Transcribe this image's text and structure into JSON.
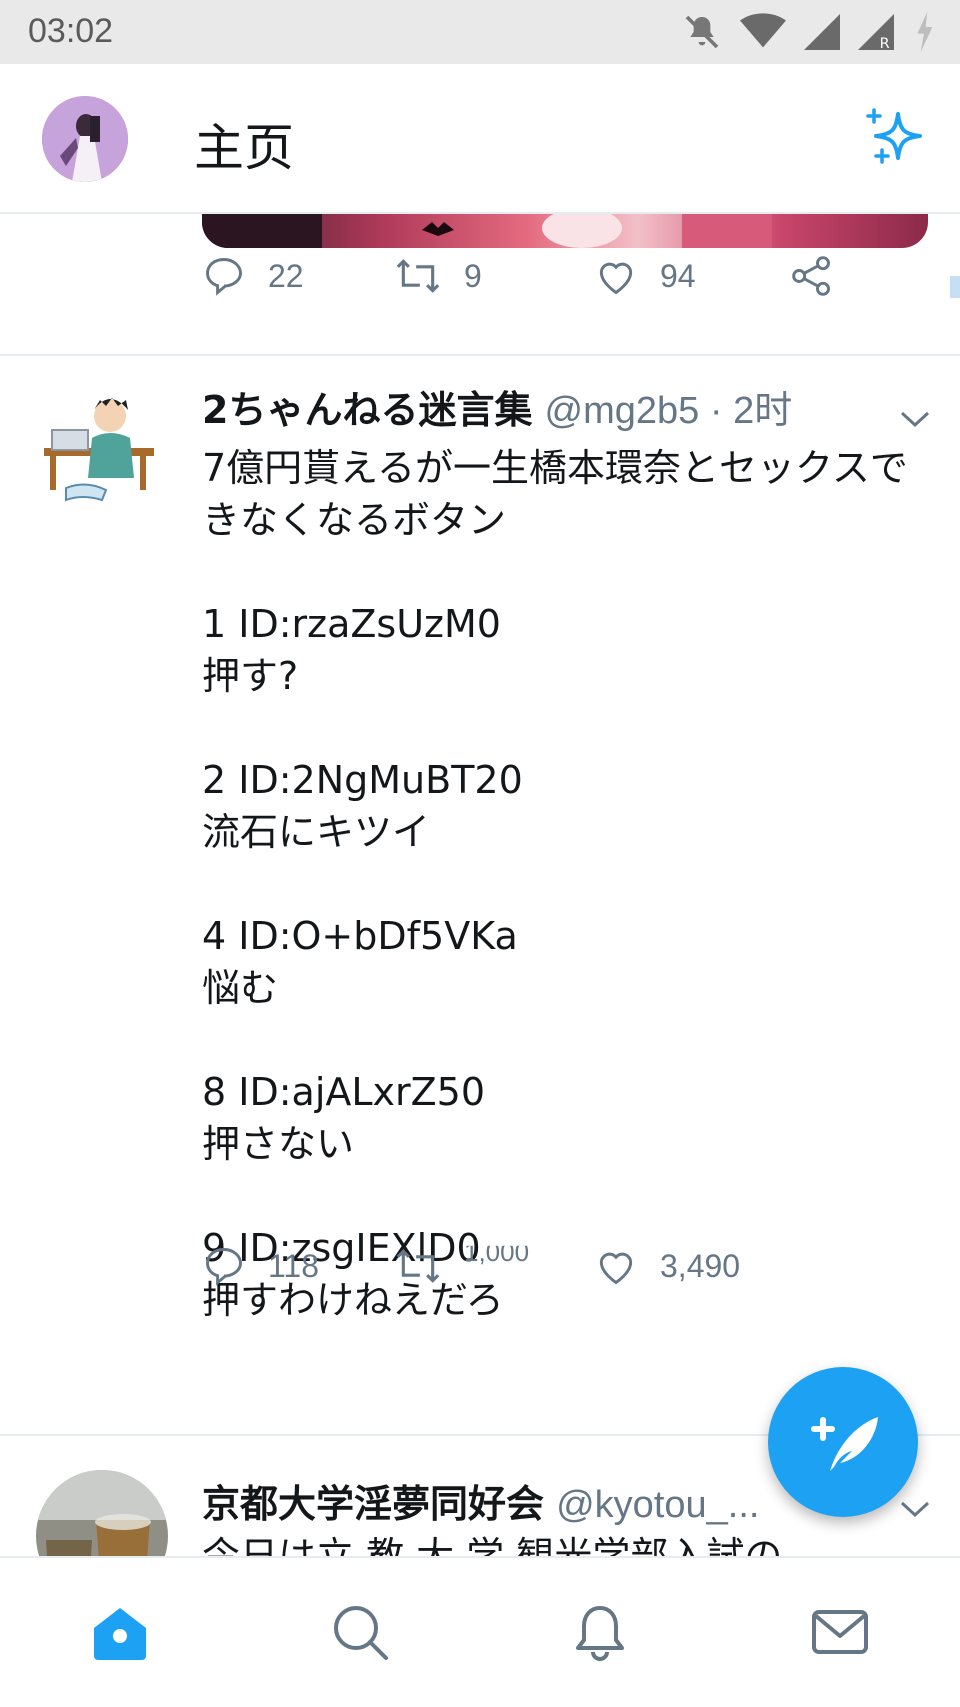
{
  "status_bar": {
    "time": "03:02"
  },
  "header": {
    "title": "主页"
  },
  "tweets": [
    {
      "reply_count": "22",
      "retweet_count": "9",
      "like_count": "94"
    },
    {
      "name": "2ちゃんねる迷言集",
      "handle": "@mg2b5",
      "time": " · 2时",
      "text": "7億円貰えるが一生橋本環奈とセックスできなくなるボタン\n\n1 ID:rzaZsUzM0\n押す?\n\n2 ID:2NgMuBT20\n流石にキツイ\n\n4 ID:O+bDf5VKa\n悩む\n\n8 ID:ajALxrZ50\n押さない\n\n9 ID:zsgIEXlD0\n押すわけねえだろ",
      "reply_count": "118",
      "retweet_count": "1,000",
      "like_count": "3,490"
    },
    {
      "name": "京都大学淫夢同好会",
      "handle": "@kyotou_...",
      "text": "今日は立 教 大 学 観光学部入試の"
    }
  ],
  "colors": {
    "accent": "#1da1f2",
    "muted": "#657786"
  },
  "nav": [
    "home-icon",
    "search-icon",
    "bell-icon",
    "mail-icon"
  ]
}
